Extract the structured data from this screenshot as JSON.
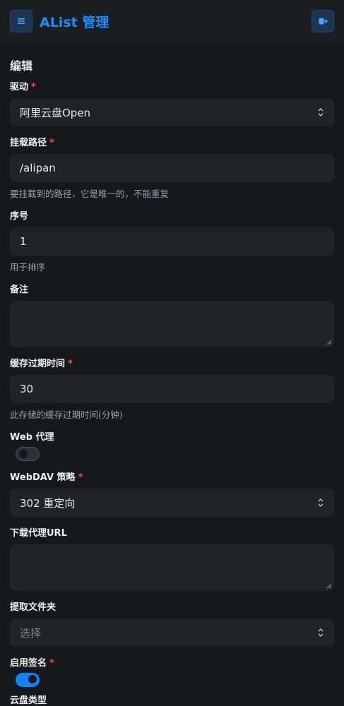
{
  "header": {
    "title": "AList 管理",
    "menu_icon": "hamburger-icon",
    "logout_icon": "logout-icon"
  },
  "form": {
    "section_title": "编辑",
    "driver": {
      "label": "驱动",
      "required": "*",
      "value": "阿里云盘Open"
    },
    "mount_path": {
      "label": "挂载路径",
      "required": "*",
      "value": "/alipan",
      "help": "要挂载到的路径，它是唯一的，不能重复"
    },
    "order": {
      "label": "序号",
      "value": "1",
      "help": "用于排序"
    },
    "remark": {
      "label": "备注",
      "value": ""
    },
    "cache_expiration": {
      "label": "缓存过期时间",
      "required": "*",
      "value": "30",
      "help": "此存储的缓存过期时间(分钟)"
    },
    "web_proxy": {
      "label": "Web 代理",
      "enabled": false
    },
    "webdav_policy": {
      "label": "WebDAV 策略",
      "required": "*",
      "value": "302 重定向"
    },
    "download_proxy_url": {
      "label": "下载代理URL",
      "value": ""
    },
    "extract_folder": {
      "label": "提取文件夹",
      "placeholder": "选择"
    },
    "enable_sign": {
      "label": "启用签名",
      "required": "*",
      "enabled": true
    },
    "drive_type": {
      "label": "云盘类型"
    }
  },
  "colors": {
    "accent": "#1a8cff",
    "required": "#f5475a",
    "toggle_on": "#0f84f5"
  }
}
